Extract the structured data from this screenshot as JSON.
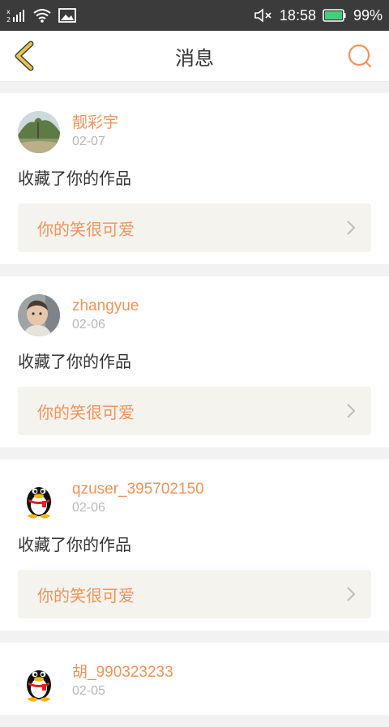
{
  "status_bar": {
    "time": "18:58",
    "battery": "99%",
    "icons": [
      "sim-signal-icon",
      "wifi-icon",
      "image-notification-icon",
      "mute-icon",
      "battery-icon"
    ]
  },
  "header": {
    "title": "消息",
    "back_icon": "chevron-left-icon",
    "search_icon": "search-icon",
    "accent": "#f0935a",
    "back_color": "#e8c64a"
  },
  "messages": [
    {
      "user": "靓彩宇",
      "date": "02-07",
      "action": "收藏了你的作品",
      "work_title": "你的笑很可爱",
      "avatar": "landscape-avatar"
    },
    {
      "user": "zhangyue",
      "date": "02-06",
      "action": "收藏了你的作品",
      "work_title": "你的笑很可爱",
      "avatar": "baby-photo-avatar"
    },
    {
      "user": "qzuser_395702150",
      "date": "02-06",
      "action": "收藏了你的作品",
      "work_title": "你的笑很可爱",
      "avatar": "qq-penguin-avatar"
    },
    {
      "user": "胡_990323233",
      "date": "02-05",
      "action": "",
      "work_title": "",
      "avatar": "qq-penguin-avatar"
    }
  ]
}
